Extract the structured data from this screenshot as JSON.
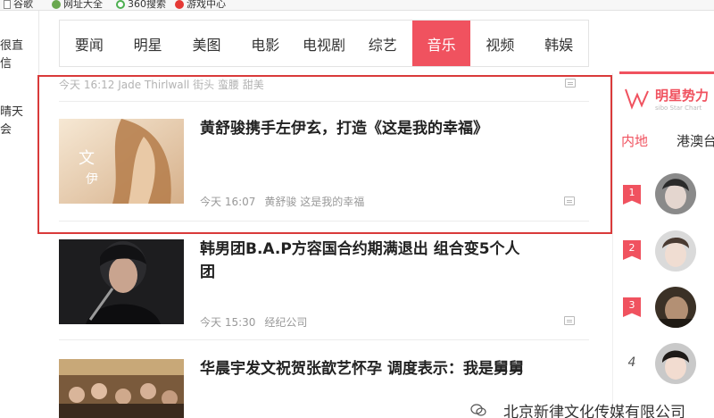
{
  "bookmarks": [
    "谷歌",
    "网址大全",
    "360搜索",
    "游戏中心"
  ],
  "left_fragments": [
    "很直",
    "信",
    "晴天",
    "会"
  ],
  "nav": {
    "items": [
      "要闻",
      "明星",
      "美图",
      "电影",
      "电视剧",
      "综艺",
      "音乐",
      "视频",
      "韩娱"
    ],
    "active_index": 6
  },
  "feed": {
    "prev_meta": "今天 16:12   Jade Thirlwall 街头 蛮腰 甜美",
    "articles": [
      {
        "title": "黄舒骏携手左伊玄，打造《这是我的幸福》",
        "time": "今天 16:07",
        "tags": "黄舒骏 这是我的幸福"
      },
      {
        "title_line1": "韩男团B.A.P方容国合约期满退出 组合变5个人",
        "title_line2": "团",
        "time": "今天 15:30",
        "tags": "经纪公司"
      },
      {
        "title": "华晨宇发文祝贺张歆艺怀孕 调度表示：我是舅舅"
      }
    ]
  },
  "sidebar": {
    "title": "明星势力",
    "subtitle": "sibo Star Chart",
    "tabs": [
      "内地",
      "港澳台"
    ],
    "ranks": [
      "1",
      "2",
      "3",
      "4"
    ]
  },
  "watermark": "北京新律文化传媒有限公司",
  "colors": {
    "accent": "#f0525f",
    "highlight_border": "#d93a3a"
  }
}
